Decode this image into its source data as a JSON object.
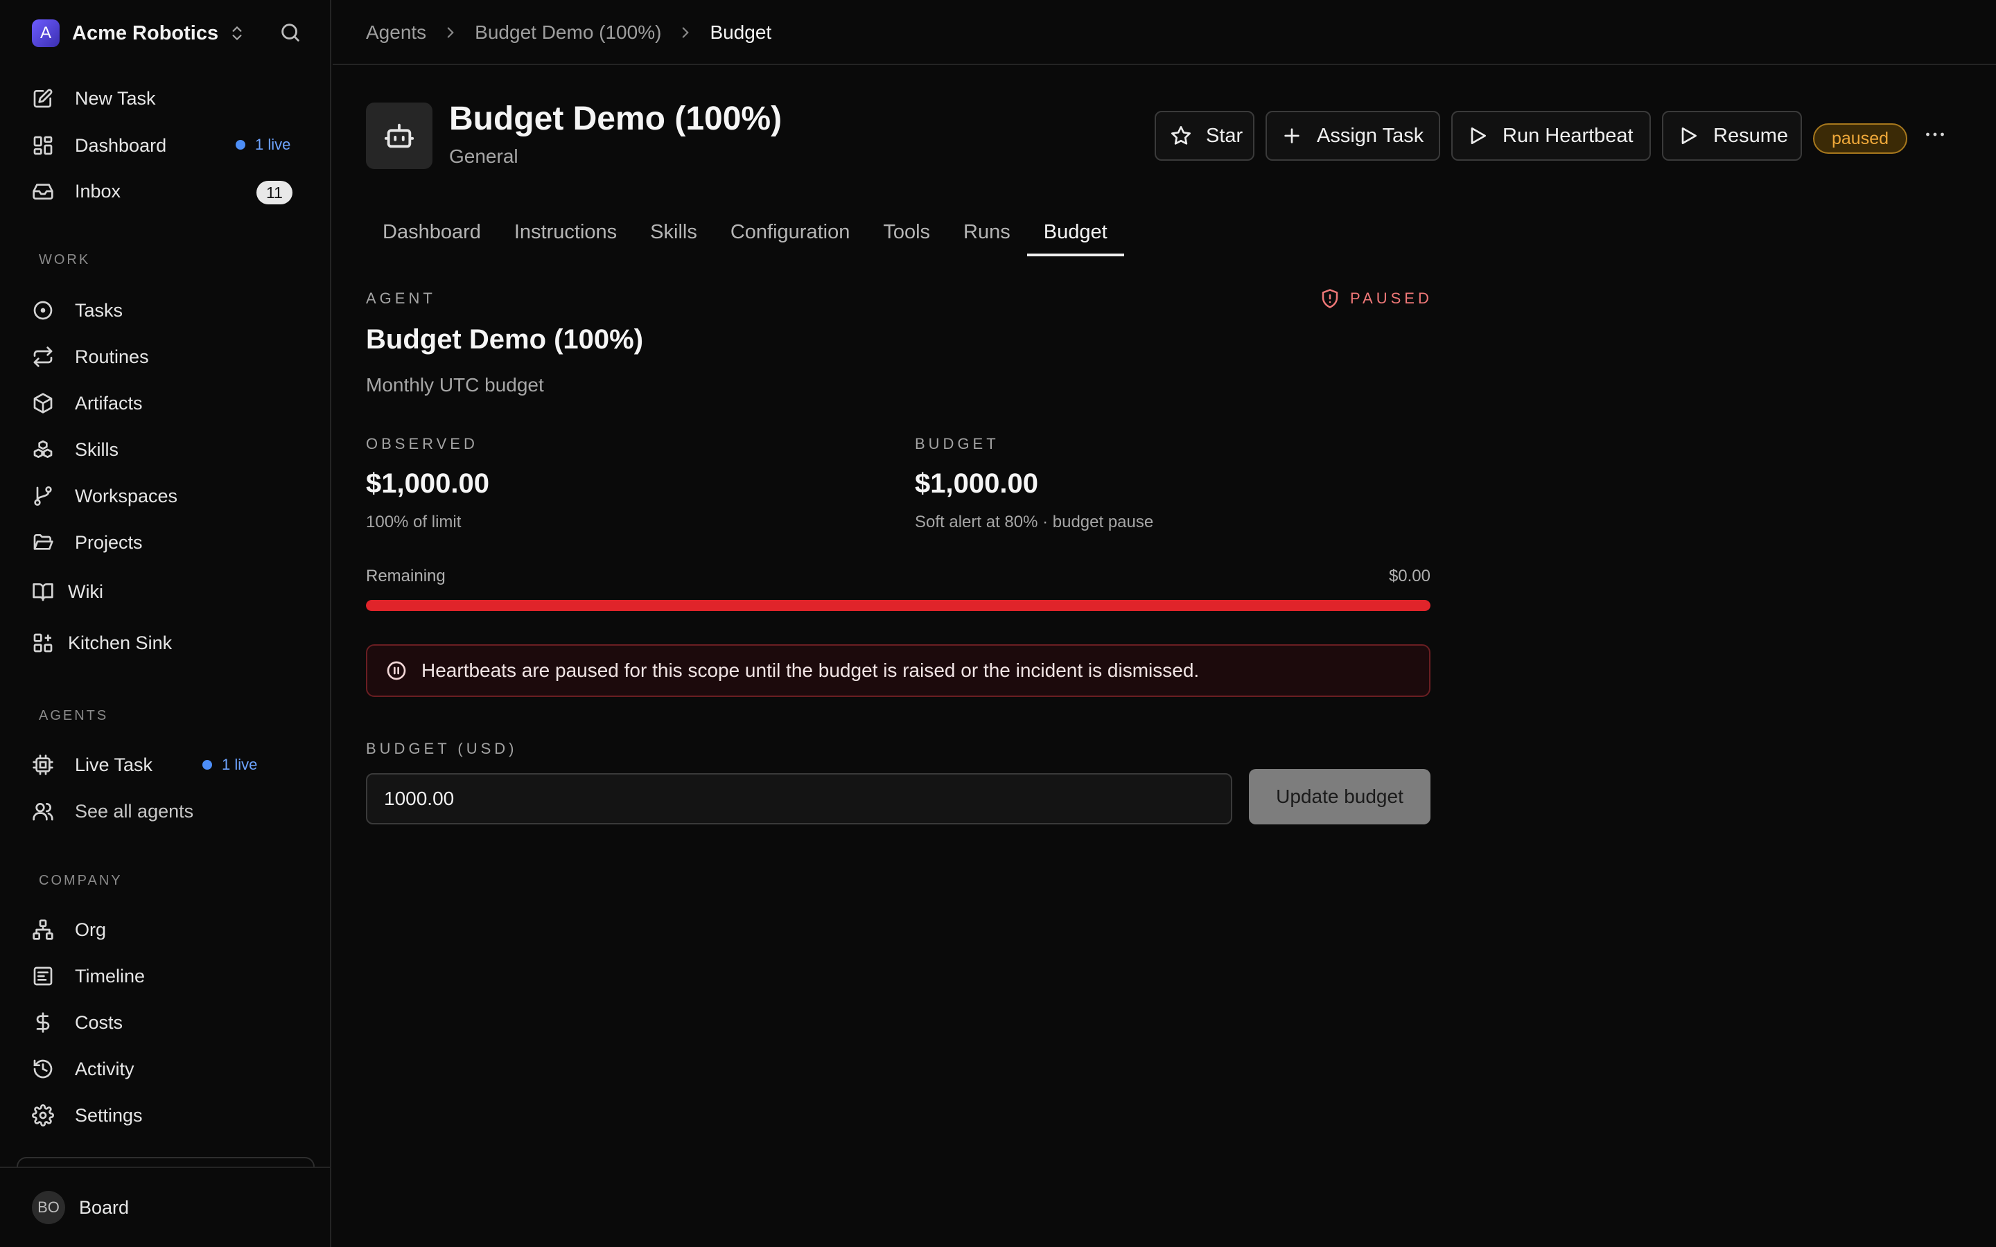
{
  "workspace": {
    "logo_letter": "A",
    "name": "Acme Robotics"
  },
  "nav": {
    "new_task": "New Task",
    "dashboard": "Dashboard",
    "dashboard_live": "1 live",
    "inbox": "Inbox",
    "inbox_count": "11"
  },
  "work": {
    "label": "WORK",
    "items": [
      "Tasks",
      "Routines",
      "Artifacts",
      "Skills",
      "Workspaces",
      "Projects",
      "Wiki",
      "Kitchen Sink"
    ]
  },
  "agents_section": {
    "label": "AGENTS",
    "live_task": "Live Task",
    "live_task_live": "1 live",
    "see_all": "See all agents"
  },
  "company": {
    "label": "COMPANY",
    "items": [
      "Org",
      "Timeline",
      "Costs",
      "Activity",
      "Settings"
    ]
  },
  "user": {
    "initials": "BO",
    "name": "Board"
  },
  "breadcrumbs": [
    "Agents",
    "Budget Demo (100%)",
    "Budget"
  ],
  "agent": {
    "title": "Budget Demo (100%)",
    "subtitle": "General",
    "status": "paused",
    "actions": {
      "star": "Star",
      "assign_task": "Assign Task",
      "run_heartbeat": "Run Heartbeat",
      "resume": "Resume"
    }
  },
  "tabs": [
    "Dashboard",
    "Instructions",
    "Skills",
    "Configuration",
    "Tools",
    "Runs",
    "Budget"
  ],
  "active_tab": "Budget",
  "budget_panel": {
    "eyebrow": "AGENT",
    "paused_label": "PAUSED",
    "title": "Budget Demo (100%)",
    "subtitle": "Monthly UTC budget",
    "observed_label": "OBSERVED",
    "observed_value": "$1,000.00",
    "observed_note": "100% of limit",
    "budget_label": "BUDGET",
    "budget_value": "$1,000.00",
    "budget_note": "Soft alert at 80% · budget pause",
    "remaining_label": "Remaining",
    "remaining_value": "$0.00",
    "usage_percent": 100,
    "alert_text": "Heartbeats are paused for this scope until the budget is raised or the incident is dismissed.",
    "input_label": "BUDGET (USD)",
    "input_value": "1000.00",
    "update_button": "Update budget"
  },
  "colors": {
    "accent_live": "#4d8ef7",
    "danger": "#e0242a",
    "paused_amber": "#f0a93a"
  }
}
